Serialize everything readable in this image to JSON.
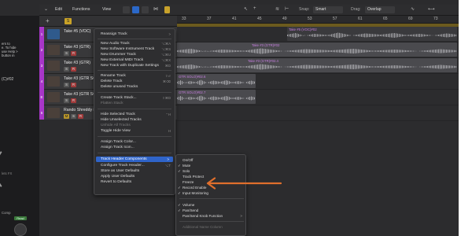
{
  "toolbar": {
    "edit": "Edit",
    "functions": "Functions",
    "view": "View",
    "snap_label": "Snap:",
    "snap_value": "Smart",
    "drag_label": "Drag:",
    "drag_value": "Overlap"
  },
  "side": {
    "t1a": "ers to",
    "t1b": "e. To hide",
    "t1c": "use Help >",
    "t1d": "button in",
    "t2": "(C)#02",
    "t3": "lets FX",
    "t4": "Comp",
    "read": "Read"
  },
  "ruler": {
    "ticks": [
      "33",
      "37",
      "41",
      "45",
      "49",
      "53",
      "57",
      "61",
      "65",
      "69",
      "73"
    ]
  },
  "tracks": [
    {
      "num": "1",
      "name": "Take #5 (VOC)",
      "m": "M",
      "s": "S",
      "r": "R"
    },
    {
      "num": "2",
      "name": "Take #3 (GTR)",
      "m": "M",
      "s": "S",
      "r": "R"
    },
    {
      "num": "3",
      "name": "Take #3 (GTR)",
      "m": "M",
      "s": "S",
      "r": "R"
    },
    {
      "num": "4",
      "name": "Take #3 (GTR SOLO)",
      "m": "M",
      "s": "S",
      "r": "R"
    },
    {
      "num": "E",
      "name": "Take #3 (GTR SOLO)",
      "m": "M",
      "s": "S",
      "r": "R"
    },
    {
      "num": "6",
      "name": "Rando Shreddy i",
      "m": "M",
      "s": "S",
      "r": "R"
    }
  ],
  "regions": {
    "r1": "Take #5 (VOC)#02",
    "r2": "Take #3 (GTR)#02",
    "r3": "Take #3 (GTR)#02.4",
    "r4": "GTR SOLO)#02.6",
    "r5": "GTR SOLO)#02.7"
  },
  "menu": [
    {
      "label": "Reassign Track",
      "sc": ">",
      "dim": false
    },
    {
      "sep": true
    },
    {
      "label": "New Audio Track",
      "sc": "⌥⌘A",
      "dim": false
    },
    {
      "label": "New Software Instrument Track",
      "sc": "⌥⌘S",
      "dim": false
    },
    {
      "label": "New Drummer Track",
      "sc": "⌥⌘U",
      "dim": false
    },
    {
      "label": "New External MIDI Track",
      "sc": "⌥⌘X",
      "dim": false
    },
    {
      "label": "New Track with Duplicate Settings",
      "sc": "⌘D",
      "dim": false
    },
    {
      "sep": true
    },
    {
      "label": "Rename Track",
      "sc": "⇧⏎",
      "dim": false
    },
    {
      "label": "Delete Track",
      "sc": "⌘⌫",
      "dim": false
    },
    {
      "label": "Delete unused Tracks",
      "sc": "",
      "dim": false
    },
    {
      "sep": true
    },
    {
      "label": "Create Track Stack...",
      "sc": "⇧⌘D",
      "dim": false
    },
    {
      "label": "Flatten Stack",
      "sc": "",
      "dim": true
    },
    {
      "sep": true
    },
    {
      "label": "Hide Selected Track",
      "sc": "⌃H",
      "dim": false
    },
    {
      "label": "Hide Unselected Tracks",
      "sc": "",
      "dim": false
    },
    {
      "label": "Unhide All Tracks",
      "sc": "",
      "dim": true
    },
    {
      "label": "Toggle Hide View",
      "sc": "H",
      "dim": false
    },
    {
      "sep": true
    },
    {
      "label": "Assign Track Color...",
      "sc": "",
      "dim": false
    },
    {
      "label": "Assign Track Icon...",
      "sc": "",
      "dim": false
    },
    {
      "sep": true
    },
    {
      "label": "Track Header Components",
      "sc": ">",
      "dim": false,
      "hl": true
    },
    {
      "label": "Configure Track Header...",
      "sc": "⌥T",
      "dim": false
    },
    {
      "label": "Store as User Defaults",
      "sc": "",
      "dim": false
    },
    {
      "label": "Apply User Defaults",
      "sc": "",
      "dim": false
    },
    {
      "label": "Revert to Defaults",
      "sc": "",
      "dim": false
    }
  ],
  "submenu": [
    {
      "label": "On/Off",
      "check": false,
      "sc": ""
    },
    {
      "label": "Mute",
      "check": true,
      "sc": ""
    },
    {
      "label": "Solo",
      "check": true,
      "sc": ""
    },
    {
      "label": "Track Protect",
      "check": false,
      "sc": ""
    },
    {
      "label": "Freeze",
      "check": false,
      "sc": ""
    },
    {
      "label": "Record Enable",
      "check": true,
      "sc": ""
    },
    {
      "label": "Input Monitoring",
      "check": true,
      "sc": ""
    },
    {
      "sep": true
    },
    {
      "label": "Volume",
      "check": true,
      "sc": ""
    },
    {
      "label": "Pan/Send",
      "check": true,
      "sc": ""
    },
    {
      "label": "Pan/Send Knob Function",
      "check": false,
      "sc": ">"
    },
    {
      "sep": true
    },
    {
      "label": "Additional Name Column",
      "check": false,
      "sc": "",
      "cut": true
    }
  ],
  "colors": {
    "accent": "#2f64c9",
    "track_color": "#a836c8",
    "annotation_arrow": "#e06f2c"
  }
}
